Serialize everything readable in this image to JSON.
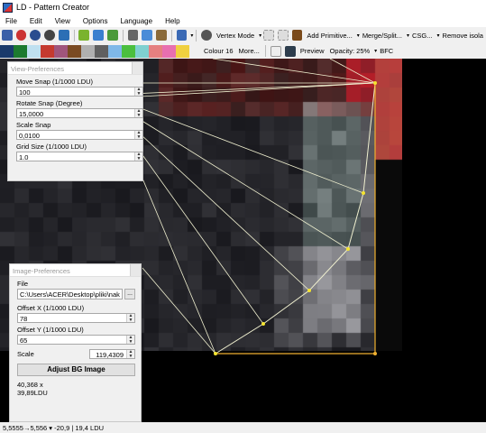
{
  "window": {
    "title": "LD - Pattern Creator"
  },
  "menu": [
    "File",
    "Edit",
    "View",
    "Options",
    "Language",
    "Help"
  ],
  "toolbar": {
    "vertex_mode": "Vertex Mode",
    "add_primitive": "Add Primitive...",
    "merge_split": "Merge/Split...",
    "csg": "CSG...",
    "remove_isolated": "Remove isola"
  },
  "toolbar2": {
    "swatches": [
      "#1a3a6b",
      "#1d7a2f",
      "#bfe0f0",
      "#c53a2f",
      "#a0557c",
      "#7a4a22",
      "#b0b0b0",
      "#606060",
      "#7fb8e8",
      "#4bbf3f",
      "#7fd0d0",
      "#e58080",
      "#e86fb0",
      "#f0d040"
    ],
    "colour": "Colour 16",
    "more": "More...",
    "preview": "Preview",
    "opacity": "Opacity: 25%",
    "bfc": "BFC"
  },
  "view_preferences": {
    "title": "View-Preferences",
    "move_snap_label": "Move Snap (1/1000 LDU)",
    "move_snap": "100",
    "rotate_snap_label": "Rotate Snap (Degree)",
    "rotate_snap": "15,0000",
    "scale_snap_label": "Scale Snap",
    "scale_snap": "0,0100",
    "grid_size_label": "Grid Size (1/1000 LDU)",
    "grid_size": "1.0"
  },
  "image_preferences": {
    "title": "Image-Preferences",
    "file_label": "File",
    "file_path": "C:\\Users\\ACER\\Desktop\\pliki\\nak",
    "browse": "...",
    "offset_x_label": "Offset X (1/1000 LDU)",
    "offset_x": "78",
    "offset_y_label": "Offset Y (1/1000 LDU)",
    "offset_y": "65",
    "scale_label": "Scale",
    "scale": "119,4309",
    "adjust_button": "Adjust BG Image",
    "dims_line1": "40,368 x",
    "dims_line2": "39,89LDU"
  },
  "status": {
    "text": "5,5555→5,556 ▾ -20,9 | 19,4 LDU"
  }
}
